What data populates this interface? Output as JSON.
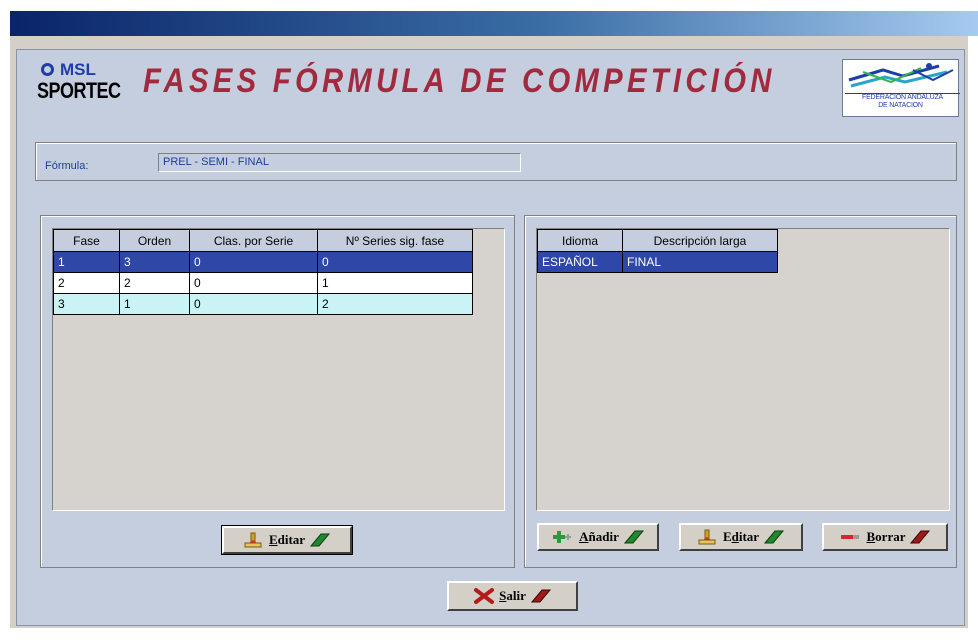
{
  "colors": {
    "title": "#a12a3e",
    "panel_bg": "#c5cede",
    "selected_row": "#2f47a7",
    "alt_row": "#c9f3f4",
    "label_text": "#1e3c9a"
  },
  "logo": {
    "line1": "MSL",
    "line2": "SPORTEC"
  },
  "header": {
    "title": "FASES FÓRMULA DE COMPETICIÓN"
  },
  "federation": {
    "line1": "FEDERACION ANDALUZA",
    "line2": "DE NATACION"
  },
  "formula": {
    "label": "Fórmula:",
    "value": "PREL - SEMI - FINAL"
  },
  "phases": {
    "columns": [
      "Fase",
      "Orden",
      "Clas. por Serie",
      "Nº Series sig. fase"
    ],
    "rows": [
      [
        "1",
        "3",
        "0",
        "0"
      ],
      [
        "2",
        "2",
        "0",
        "1"
      ],
      [
        "3",
        "1",
        "0",
        "2"
      ]
    ],
    "edit_button": {
      "accel": "E",
      "rest": "ditar",
      "icon": "edit-icon"
    }
  },
  "descriptions": {
    "columns": [
      "Idioma",
      "Descripción larga"
    ],
    "rows": [
      [
        "ESPAÑOL",
        "FINAL"
      ]
    ],
    "add_button": {
      "accel": "A",
      "rest": "ñadir",
      "icon": "plus-icon"
    },
    "edit_button": {
      "pre": "E",
      "accel": "d",
      "rest": "itar",
      "icon": "edit-icon"
    },
    "delete_button": {
      "accel": "B",
      "rest": "orrar",
      "icon": "minus-icon"
    }
  },
  "exit_button": {
    "accel": "S",
    "rest": "alir",
    "icon": "close-x-icon"
  }
}
